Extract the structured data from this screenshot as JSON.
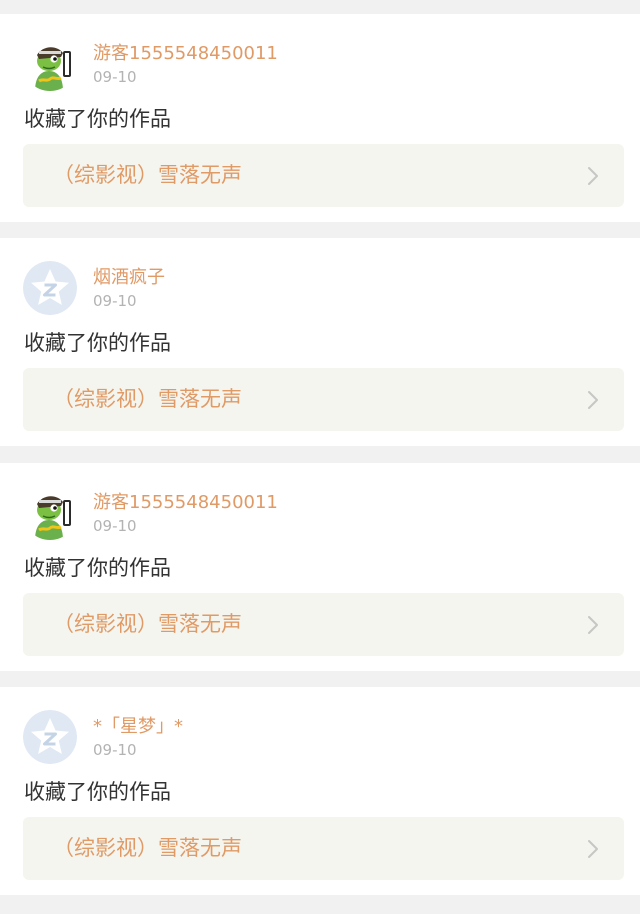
{
  "notifications": [
    {
      "avatar": "snake-avatar-icon",
      "username": "游客1555548450011",
      "date": "09-10",
      "action": "收藏了你的作品",
      "work_title": "（综影视）雪落无声"
    },
    {
      "avatar": "default-avatar-icon",
      "username": "烟酒疯子",
      "date": "09-10",
      "action": "收藏了你的作品",
      "work_title": "（综影视）雪落无声"
    },
    {
      "avatar": "snake-avatar-icon",
      "username": "游客1555548450011",
      "date": "09-10",
      "action": "收藏了你的作品",
      "work_title": "（综影视）雪落无声"
    },
    {
      "avatar": "default-avatar-icon",
      "username": "*「星梦」*",
      "date": "09-10",
      "action": "收藏了你的作品",
      "work_title": "（综影视）雪落无声"
    }
  ],
  "colors": {
    "accent": "#e09a66",
    "date": "#b3b3b3",
    "text": "#333333",
    "link_bg": "#f5f5ef",
    "page_bg": "#f1f1f1"
  }
}
